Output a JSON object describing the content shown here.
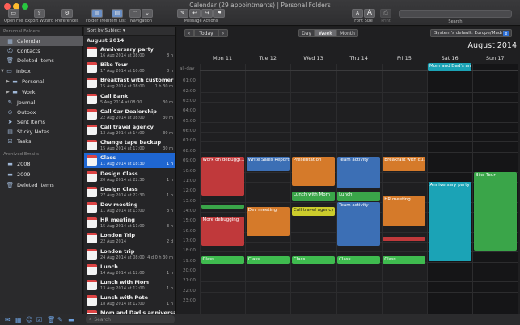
{
  "window": {
    "title": "Calendar (29 appointments) | Personal Folders"
  },
  "toolbar": {
    "open_file": "Open File",
    "export_wizard": "Export Wizard",
    "preferences": "Preferences",
    "folder_tree": "Folder Tree",
    "item_list": "Item List",
    "navigation": "Navigation",
    "message_actions": "Message Actions",
    "font_size": "Font Size",
    "font_a_small": "A",
    "font_a_large": "A",
    "print": "Print",
    "search": "Search"
  },
  "sidebar": {
    "header_personal": "Personal Folders",
    "items": [
      {
        "label": "Calendar",
        "icon": "calendar-icon"
      },
      {
        "label": "Contacts",
        "icon": "contacts-icon"
      },
      {
        "label": "Deleted Items",
        "icon": "trash-icon"
      },
      {
        "label": "Inbox",
        "icon": "inbox-icon"
      },
      {
        "label": "Personal",
        "icon": "folder-icon"
      },
      {
        "label": "Work",
        "icon": "folder-icon"
      },
      {
        "label": "Journal",
        "icon": "journal-icon"
      },
      {
        "label": "Outbox",
        "icon": "outbox-icon"
      },
      {
        "label": "Sent Items",
        "icon": "sent-icon"
      },
      {
        "label": "Sticky Notes",
        "icon": "notes-icon"
      },
      {
        "label": "Tasks",
        "icon": "tasks-icon"
      }
    ],
    "header_archived": "Archived Emails",
    "archived": [
      {
        "label": "2008"
      },
      {
        "label": "2009"
      },
      {
        "label": "Deleted Items"
      }
    ]
  },
  "list": {
    "sort_label": "Sort by Subject ▾",
    "month": "August 2014",
    "search_placeholder": "Search",
    "items": [
      {
        "title": "Anniversary party",
        "date": "16 Aug 2014 at 08:00",
        "dur": "8 h"
      },
      {
        "title": "Bike Tour",
        "date": "17 Aug 2014 at 10:00",
        "dur": "8 h"
      },
      {
        "title": "Breakfast with customer",
        "date": "15 Aug 2014 at 08:00",
        "dur": "1 h 30 m"
      },
      {
        "title": "Call Bank",
        "date": "5 Aug 2014 at 08:00",
        "dur": "30 m"
      },
      {
        "title": "Call Car Dealership",
        "date": "22 Aug 2014 at 08:00",
        "dur": "30 m"
      },
      {
        "title": "Call travel agency",
        "date": "13 Aug 2014 at 14:00",
        "dur": "30 m"
      },
      {
        "title": "Change tape backup",
        "date": "15 Aug 2014 at 17:00",
        "dur": "30 m"
      },
      {
        "title": "Class",
        "date": "11 Aug 2014 at 18:30",
        "dur": "1 h"
      },
      {
        "title": "Design Class",
        "date": "20 Aug 2014 at 22:30",
        "dur": "1 h"
      },
      {
        "title": "Design Class",
        "date": "27 Aug 2014 at 22:30",
        "dur": "1 h"
      },
      {
        "title": "Dev meeting",
        "date": "11 Aug 2014 at 13:00",
        "dur": "3 h"
      },
      {
        "title": "HR meeting",
        "date": "15 Aug 2014 at 11:00",
        "dur": "3 h"
      },
      {
        "title": "London Trip",
        "date": "22 Aug 2014",
        "dur": "2 d"
      },
      {
        "title": "London trip",
        "date": "24 Aug 2014 at 08:00",
        "dur": "4 d 0 h 30 m"
      },
      {
        "title": "Lunch",
        "date": "14 Aug 2014 at 12:00",
        "dur": "1 h"
      },
      {
        "title": "Lunch with Mom",
        "date": "13 Aug 2014 at 12:00",
        "dur": "1 h"
      },
      {
        "title": "Lunch with Pete",
        "date": "18 Aug 2014 at 12:00",
        "dur": "1 h"
      },
      {
        "title": "Mom and Dad's anniversary",
        "date": "16 Aug 2014",
        "dur": ""
      }
    ],
    "selected_index": 7
  },
  "calendar": {
    "prev": "‹",
    "today": "Today",
    "next": "›",
    "views": [
      "Day",
      "Week",
      "Month"
    ],
    "active_view": "Week",
    "timezone": "System's default: Europe/Madrid",
    "month_title": "August 2014",
    "allday_label": "all-day",
    "days": [
      "Mon 11",
      "Tue 12",
      "Wed 13",
      "Thu 14",
      "Fri 15",
      "Sat 16",
      "Sun 17"
    ],
    "hours": [
      "01:00",
      "02:00",
      "03:00",
      "04:00",
      "05:00",
      "06:00",
      "07:00",
      "08:00",
      "09:00",
      "10:00",
      "11:00",
      "12:00",
      "13:00",
      "14:00",
      "15:00",
      "16:00",
      "17:00",
      "18:00",
      "19:00",
      "20:00",
      "21:00",
      "22:00",
      "23:00"
    ],
    "allday_events": [
      {
        "day": 5,
        "title": "Mom and Dad's an...",
        "color": "#1ba3b6"
      }
    ],
    "events": [
      {
        "day": 0,
        "start": 8.5,
        "end": 12.5,
        "title": "Work on debuggi...",
        "color": "#c0393b"
      },
      {
        "day": 0,
        "start": 13.25,
        "end": 13.75,
        "title": "",
        "color": "#3aa549"
      },
      {
        "day": 0,
        "start": 14.5,
        "end": 17.5,
        "title": "More debugging",
        "color": "#c0393b"
      },
      {
        "day": 0,
        "start": 18.5,
        "end": 19.25,
        "title": "Class",
        "color": "#3fbb4f"
      },
      {
        "day": 1,
        "start": 8.5,
        "end": 10.0,
        "title": "Write Sales Report",
        "color": "#3c6fb5"
      },
      {
        "day": 1,
        "start": 13.5,
        "end": 16.5,
        "title": "Dev meeting",
        "color": "#d57a2a"
      },
      {
        "day": 1,
        "start": 18.5,
        "end": 19.25,
        "title": "Class",
        "color": "#3fbb4f"
      },
      {
        "day": 2,
        "start": 8.5,
        "end": 11.5,
        "title": "Presentation",
        "color": "#d57a2a"
      },
      {
        "day": 2,
        "start": 12.0,
        "end": 13.0,
        "title": "Lunch with Mom",
        "color": "#3aa549"
      },
      {
        "day": 2,
        "start": 13.5,
        "end": 14.5,
        "title": "Call travel agency",
        "color": "#cccc2c"
      },
      {
        "day": 2,
        "start": 18.5,
        "end": 19.25,
        "title": "Class",
        "color": "#3fbb4f"
      },
      {
        "day": 3,
        "start": 8.5,
        "end": 11.75,
        "title": "Team activity",
        "color": "#3c6fb5"
      },
      {
        "day": 3,
        "start": 12.0,
        "end": 13.0,
        "title": "Lunch",
        "color": "#3aa549"
      },
      {
        "day": 3,
        "start": 13.0,
        "end": 17.5,
        "title": "Team activity",
        "color": "#3c6fb5"
      },
      {
        "day": 3,
        "start": 18.5,
        "end": 19.25,
        "title": "Class",
        "color": "#3fbb4f"
      },
      {
        "day": 4,
        "start": 8.5,
        "end": 10.0,
        "title": "Breakfast with cu...",
        "color": "#d57a2a"
      },
      {
        "day": 4,
        "start": 12.5,
        "end": 15.5,
        "title": "HR meeting",
        "color": "#d57a2a"
      },
      {
        "day": 4,
        "start": 16.5,
        "end": 17.0,
        "title": "",
        "color": "#c0393b"
      },
      {
        "day": 4,
        "start": 18.5,
        "end": 19.25,
        "title": "Class",
        "color": "#3fbb4f"
      },
      {
        "day": 5,
        "start": 11.0,
        "end": 19.0,
        "title": "Anniversary party",
        "color": "#1ba3b6"
      },
      {
        "day": 6,
        "start": 10.0,
        "end": 18.0,
        "title": "Bike Tour",
        "color": "#3aa549"
      }
    ]
  },
  "bottombar": {
    "icons": [
      "mail-icon",
      "calendar-icon",
      "contacts-icon",
      "tasks-icon",
      "trash-icon",
      "notes-icon",
      "folder-icon"
    ]
  }
}
